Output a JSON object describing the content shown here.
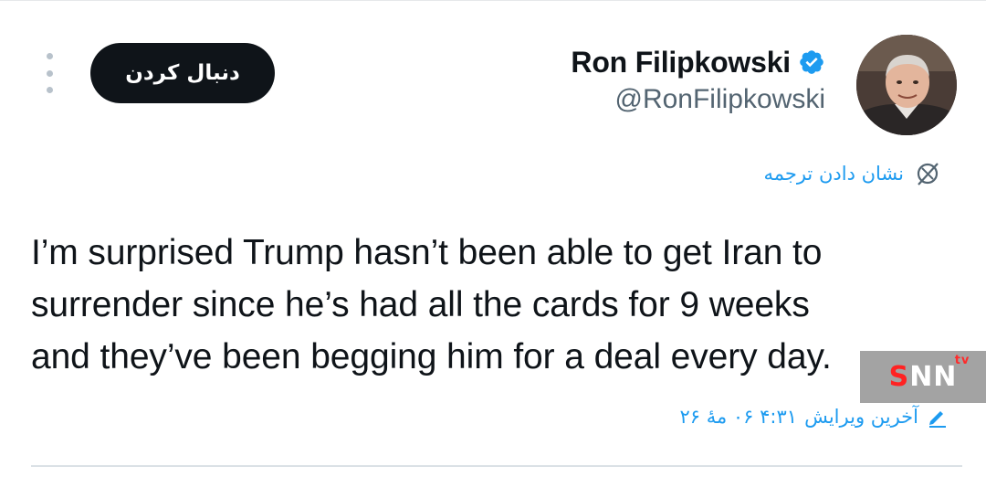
{
  "tweet": {
    "author": {
      "display_name": "Ron Filipkowski",
      "handle": "@RonFilipkowski",
      "verified": true
    },
    "actions": {
      "follow_label": "دنبال کردن"
    },
    "translate_label": "نشان دادن ترجمه",
    "lines": [
      "I’m surprised Trump hasn’t been able to get Iran to",
      "surrender since he’s had all the cards for 9 weeks",
      "and they’ve been begging him for a deal every day."
    ],
    "edited": {
      "label": "آخرین ویرایش",
      "datetime": "۴:۳۱ ۰۶ مهٔ ۲۶"
    }
  },
  "watermark": {
    "brand": "SNN",
    "suffix": "tv"
  },
  "colors": {
    "accent": "#1d9bf0",
    "text": "#0f1419",
    "secondary_text": "#536471",
    "follow_button_bg": "#0f1419"
  },
  "icons": {
    "verified": "verified-badge-icon",
    "translate": "globe-icon",
    "edited": "pencil-icon",
    "more": "more-vertical-icon"
  }
}
